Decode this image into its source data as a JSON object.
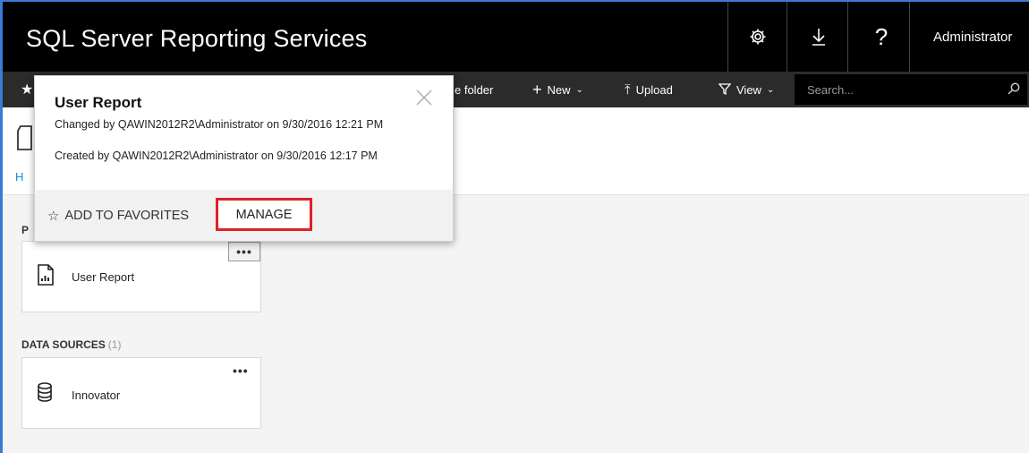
{
  "header": {
    "app_title": "SQL Server Reporting Services",
    "settings_icon": "gear-icon",
    "download_icon": "download-icon",
    "help_label": "?",
    "user_label": "Administrator"
  },
  "toolbar": {
    "favorites_icon": "star-icon",
    "new_folder_label": "e folder",
    "new_label": "New",
    "upload_label": "Upload",
    "view_label": "View",
    "search_placeholder": "Search..."
  },
  "breadcrumb": {
    "home_label": "H"
  },
  "sections": {
    "paginated_label": "P",
    "data_sources_label": "DATA SOURCES",
    "data_sources_count": "(1)"
  },
  "tiles": {
    "report_label": "User Report",
    "datasource_label": "Innovator",
    "more_label": "•••"
  },
  "popup": {
    "title": "User Report",
    "changed_text": "Changed by QAWIN2012R2\\Administrator on 9/30/2016 12:21 PM",
    "created_text": "Created by QAWIN2012R2\\Administrator on 9/30/2016 12:17 PM",
    "close_label": "✕",
    "add_favorites_label": "ADD TO FAVORITES",
    "manage_label": "MANAGE",
    "highlight_color": "#e0202a"
  }
}
